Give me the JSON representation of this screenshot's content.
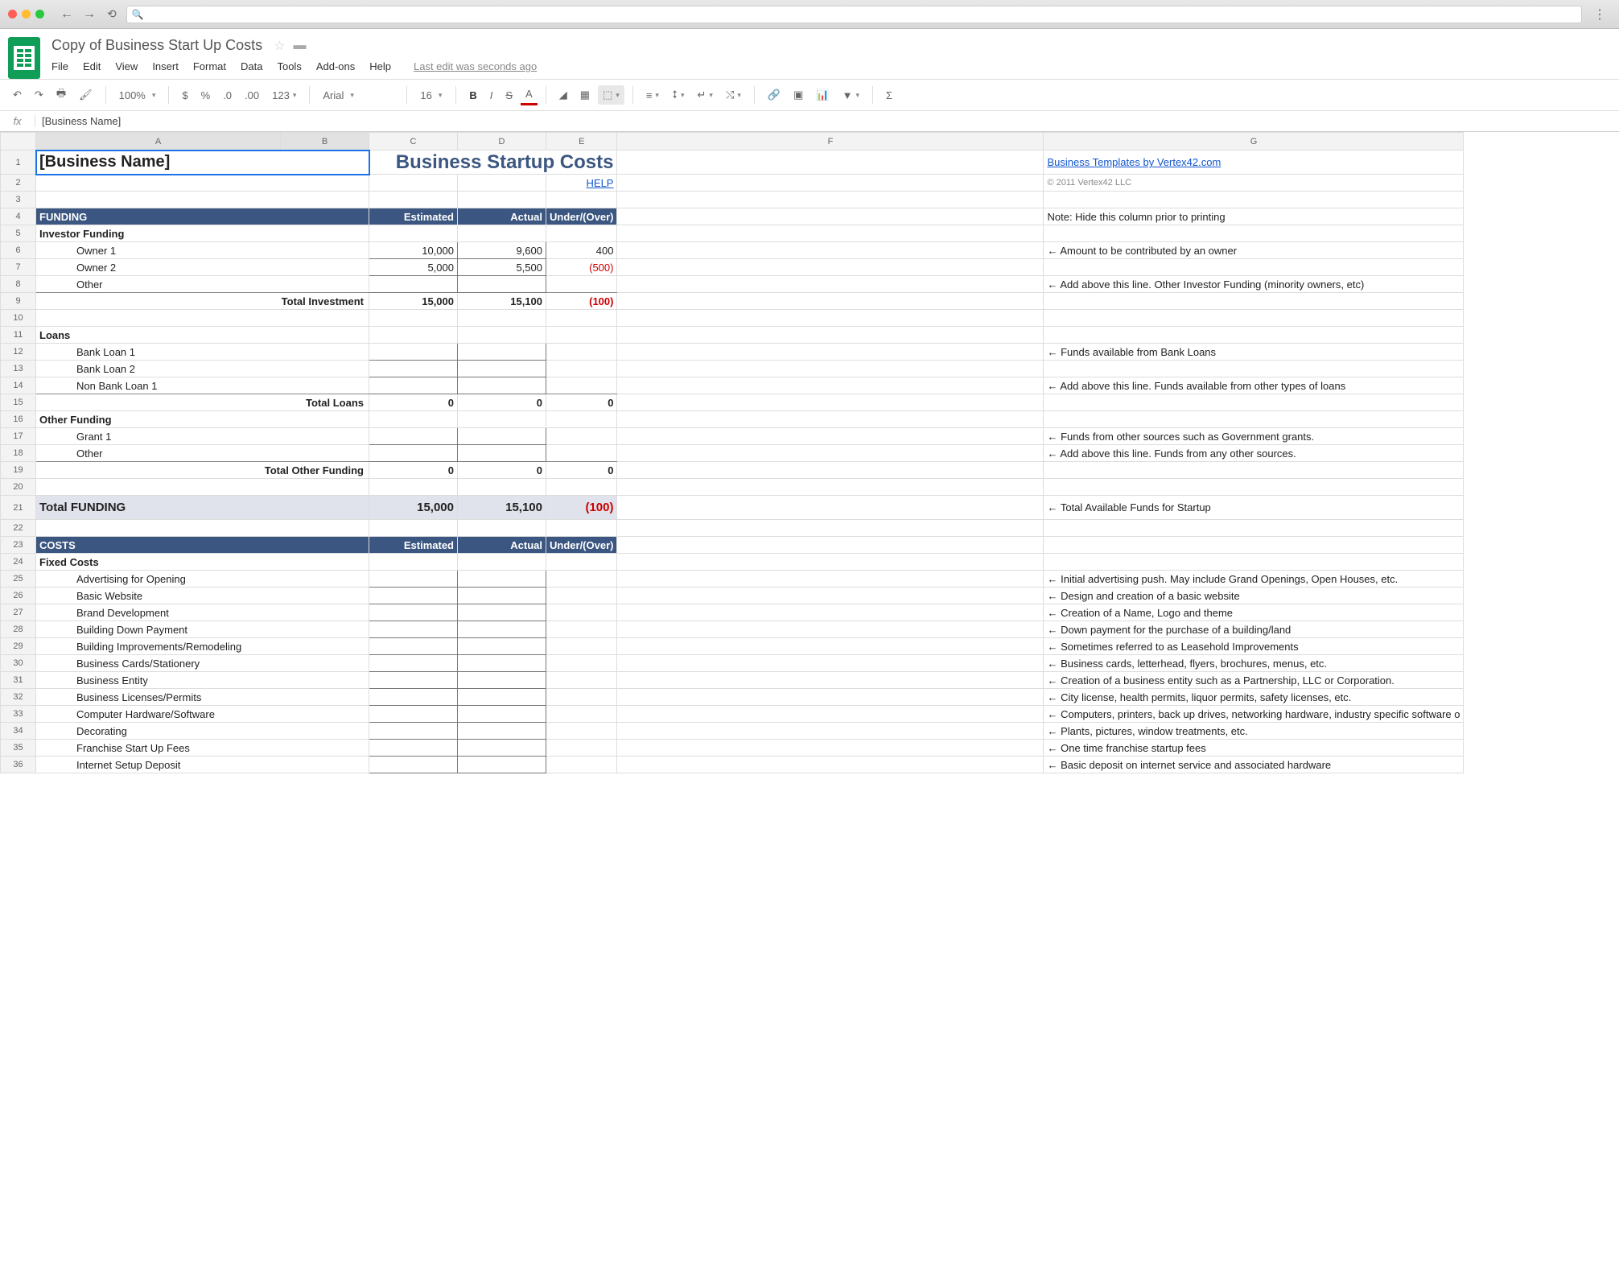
{
  "browser": {
    "url_prefix": "🔍"
  },
  "doc": {
    "title": "Copy of Business Start Up Costs",
    "menus": [
      "File",
      "Edit",
      "View",
      "Insert",
      "Format",
      "Data",
      "Tools",
      "Add-ons",
      "Help"
    ],
    "last_edit": "Last edit was seconds ago"
  },
  "toolbar": {
    "zoom": "100%",
    "font": "Arial",
    "size": "16"
  },
  "formula": {
    "value": "[Business Name]"
  },
  "columns": [
    "A",
    "B",
    "C",
    "D",
    "E",
    "F",
    "G"
  ],
  "sheet": {
    "businessName": "[Business Name]",
    "titleRight": "Business Startup Costs",
    "templatesLink": "Business Templates by Vertex42.com",
    "helpLink": "HELP",
    "copyright": "© 2011 Vertex42 LLC",
    "noteHide": "Note: Hide this column prior to printing",
    "fundingHeader": {
      "label": "FUNDING",
      "est": "Estimated",
      "act": "Actual",
      "uo": "Under/(Over)"
    },
    "investorFunding": "Investor Funding",
    "owner1": {
      "label": "Owner 1",
      "est": "10,000",
      "act": "9,600",
      "uo": "400",
      "note": "← Amount to be contributed by an owner"
    },
    "owner2": {
      "label": "Owner 2",
      "est": "5,000",
      "act": "5,500",
      "uo": "(500)"
    },
    "otherInv": {
      "label": "Other",
      "note": "← Add above this line. Other Investor Funding (minority owners, etc)"
    },
    "totalInvestment": {
      "label": "Total Investment",
      "est": "15,000",
      "act": "15,100",
      "uo": "(100)"
    },
    "loans": "Loans",
    "bankLoan1": {
      "label": "Bank Loan 1",
      "note": "← Funds available from Bank Loans"
    },
    "bankLoan2": {
      "label": "Bank Loan 2"
    },
    "nonBankLoan": {
      "label": "Non Bank Loan 1",
      "note": "← Add above this line. Funds available from other types of loans"
    },
    "totalLoans": {
      "label": "Total Loans",
      "est": "0",
      "act": "0",
      "uo": "0"
    },
    "otherFunding": "Other Funding",
    "grant1": {
      "label": "Grant 1",
      "note": "← Funds from other sources such as Government grants."
    },
    "otherOF": {
      "label": "Other",
      "note": "← Add above this line. Funds from any other sources."
    },
    "totalOther": {
      "label": "Total Other Funding",
      "est": "0",
      "act": "0",
      "uo": "0"
    },
    "totalFunding": {
      "label": "Total FUNDING",
      "est": "15,000",
      "act": "15,100",
      "uo": "(100)",
      "note": "← Total Available Funds for Startup"
    },
    "costsHeader": {
      "label": "COSTS",
      "est": "Estimated",
      "act": "Actual",
      "uo": "Under/(Over)"
    },
    "fixedCosts": "Fixed Costs",
    "costItems": [
      {
        "label": "Advertising for Opening",
        "note": "← Initial advertising push.  May include Grand Openings, Open Houses, etc."
      },
      {
        "label": "Basic Website",
        "note": "← Design and creation of a basic website"
      },
      {
        "label": "Brand Development",
        "note": "← Creation of a Name, Logo and theme"
      },
      {
        "label": "Building Down Payment",
        "note": "← Down payment for the purchase of a building/land"
      },
      {
        "label": "Building Improvements/Remodeling",
        "note": "← Sometimes referred to as Leasehold Improvements"
      },
      {
        "label": "Business Cards/Stationery",
        "note": "← Business cards, letterhead, flyers, brochures, menus, etc."
      },
      {
        "label": "Business Entity",
        "note": "← Creation of a business entity such as a Partnership, LLC or Corporation."
      },
      {
        "label": "Business Licenses/Permits",
        "note": "← City license, health permits, liquor permits, safety licenses, etc."
      },
      {
        "label": "Computer Hardware/Software",
        "note": "← Computers, printers, back up drives, networking hardware, industry specific software o"
      },
      {
        "label": "Decorating",
        "note": "← Plants, pictures, window treatments, etc."
      },
      {
        "label": "Franchise Start Up Fees",
        "note": "← One time franchise startup fees"
      },
      {
        "label": "Internet Setup Deposit",
        "note": "← Basic deposit on internet service and associated hardware"
      }
    ]
  }
}
